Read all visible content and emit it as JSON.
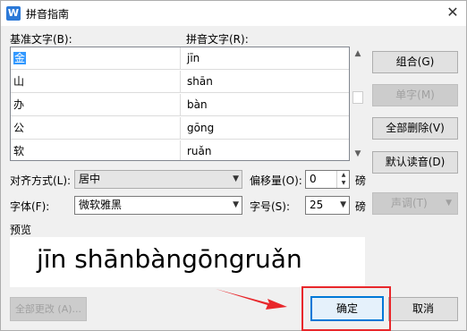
{
  "window": {
    "title": "拼音指南",
    "app_icon_letter": "W",
    "close_symbol": "✕"
  },
  "grid": {
    "base_header": "基准文字(B):",
    "pinyin_header": "拼音文字(R):",
    "rows": [
      {
        "base": "金",
        "pinyin": "jīn"
      },
      {
        "base": "山",
        "pinyin": "shān"
      },
      {
        "base": "办",
        "pinyin": "bàn"
      },
      {
        "base": "公",
        "pinyin": "gōng"
      },
      {
        "base": "软",
        "pinyin": "ruǎn"
      }
    ]
  },
  "buttons": {
    "combine": "组合(G)",
    "single": "单字(M)",
    "delete_all": "全部删除(V)",
    "default_reading": "默认读音(D)",
    "tone": "声调(T)",
    "change_all": "全部更改 (A)...",
    "ok": "确定",
    "cancel": "取消"
  },
  "options": {
    "align_label": "对齐方式(L):",
    "align_value": "居中",
    "offset_label": "偏移量(O):",
    "offset_value": "0",
    "offset_unit": "磅",
    "font_label": "字体(F):",
    "font_value": "微软雅黑",
    "size_label": "字号(S):",
    "size_value": "25",
    "size_unit": "磅"
  },
  "preview": {
    "label": "预览",
    "text": "jīn shānbàngōngruǎn"
  },
  "colors": {
    "highlight": "#e8272b",
    "accent": "#0078d7"
  }
}
